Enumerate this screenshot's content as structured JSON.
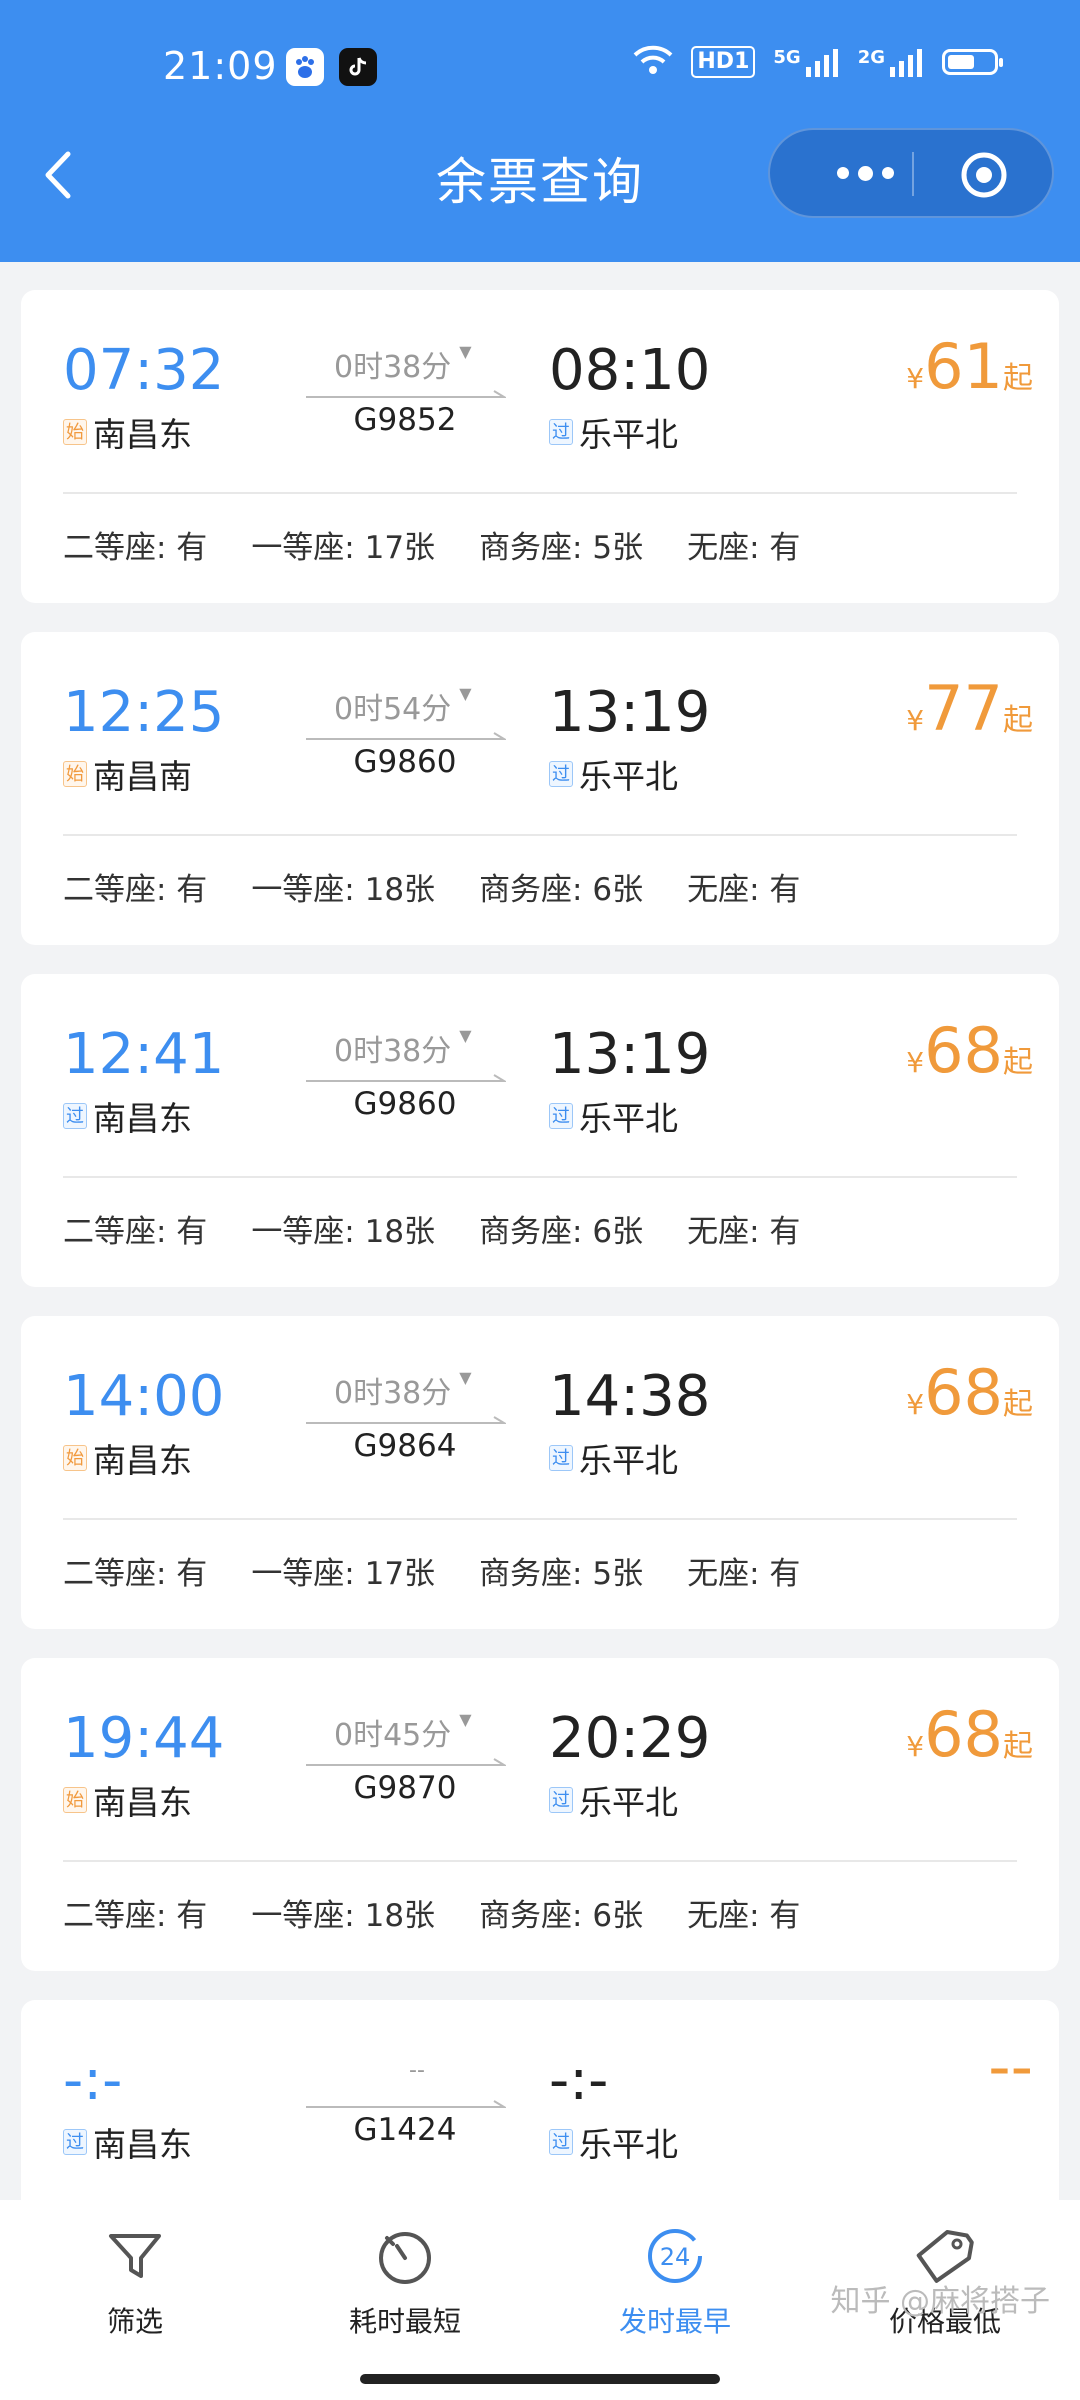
{
  "status_bar": {
    "time": "21:09",
    "hd_badge": "HD1",
    "network_1": "5G",
    "network_2": "2G",
    "battery_level": 0.6,
    "icons": [
      "baidu-app-icon",
      "tiktok-app-icon",
      "wifi-icon",
      "signal-icon",
      "battery-icon"
    ]
  },
  "header": {
    "title": "余票查询",
    "back_icon": "chevron-left-icon",
    "more_icon": "more-dots-icon",
    "close_icon": "target-circle-icon"
  },
  "tickets": [
    {
      "dep_time": "07:32",
      "dep_station": "南昌东",
      "dep_badge": "始",
      "duration": "0时38分",
      "train_no": "G9852",
      "arr_time": "08:10",
      "arr_station": "乐平北",
      "arr_badge": "过",
      "price_currency": "¥",
      "price": "61",
      "price_suffix": "起",
      "seats": [
        "二等座: 有",
        "一等座: 17张",
        "商务座: 5张",
        "无座: 有"
      ]
    },
    {
      "dep_time": "12:25",
      "dep_station": "南昌南",
      "dep_badge": "始",
      "duration": "0时54分",
      "train_no": "G9860",
      "arr_time": "13:19",
      "arr_station": "乐平北",
      "arr_badge": "过",
      "price_currency": "¥",
      "price": "77",
      "price_suffix": "起",
      "seats": [
        "二等座: 有",
        "一等座: 18张",
        "商务座: 6张",
        "无座: 有"
      ]
    },
    {
      "dep_time": "12:41",
      "dep_station": "南昌东",
      "dep_badge": "过",
      "duration": "0时38分",
      "train_no": "G9860",
      "arr_time": "13:19",
      "arr_station": "乐平北",
      "arr_badge": "过",
      "price_currency": "¥",
      "price": "68",
      "price_suffix": "起",
      "seats": [
        "二等座: 有",
        "一等座: 18张",
        "商务座: 6张",
        "无座: 有"
      ]
    },
    {
      "dep_time": "14:00",
      "dep_station": "南昌东",
      "dep_badge": "始",
      "duration": "0时38分",
      "train_no": "G9864",
      "arr_time": "14:38",
      "arr_station": "乐平北",
      "arr_badge": "过",
      "price_currency": "¥",
      "price": "68",
      "price_suffix": "起",
      "seats": [
        "二等座: 有",
        "一等座: 17张",
        "商务座: 5张",
        "无座: 有"
      ]
    },
    {
      "dep_time": "19:44",
      "dep_station": "南昌东",
      "dep_badge": "始",
      "duration": "0时45分",
      "train_no": "G9870",
      "arr_time": "20:29",
      "arr_station": "乐平北",
      "arr_badge": "过",
      "price_currency": "¥",
      "price": "68",
      "price_suffix": "起",
      "seats": [
        "二等座: 有",
        "一等座: 18张",
        "商务座: 6张",
        "无座: 有"
      ]
    },
    {
      "dep_time": "-:-",
      "dep_station": "南昌东",
      "dep_badge": "过",
      "duration": "--",
      "train_no": "G1424",
      "arr_time": "-:-",
      "arr_station": "乐平北",
      "arr_badge": "过",
      "price_currency": "",
      "price": "--",
      "price_suffix": "",
      "seats": []
    }
  ],
  "tabbar": [
    {
      "label": "筛选",
      "icon": "filter-icon",
      "active": false
    },
    {
      "label": "耗时最短",
      "icon": "stopwatch-icon",
      "active": false
    },
    {
      "label": "发时最早",
      "icon": "clock-24-icon",
      "active": true
    },
    {
      "label": "价格最低",
      "icon": "price-tag-icon",
      "active": false
    }
  ],
  "watermark": "知乎 @麻将搭子",
  "colors": {
    "header_blue": "#3d8ef0",
    "price_orange": "#f09a3b",
    "background": "#f2f3f5"
  }
}
